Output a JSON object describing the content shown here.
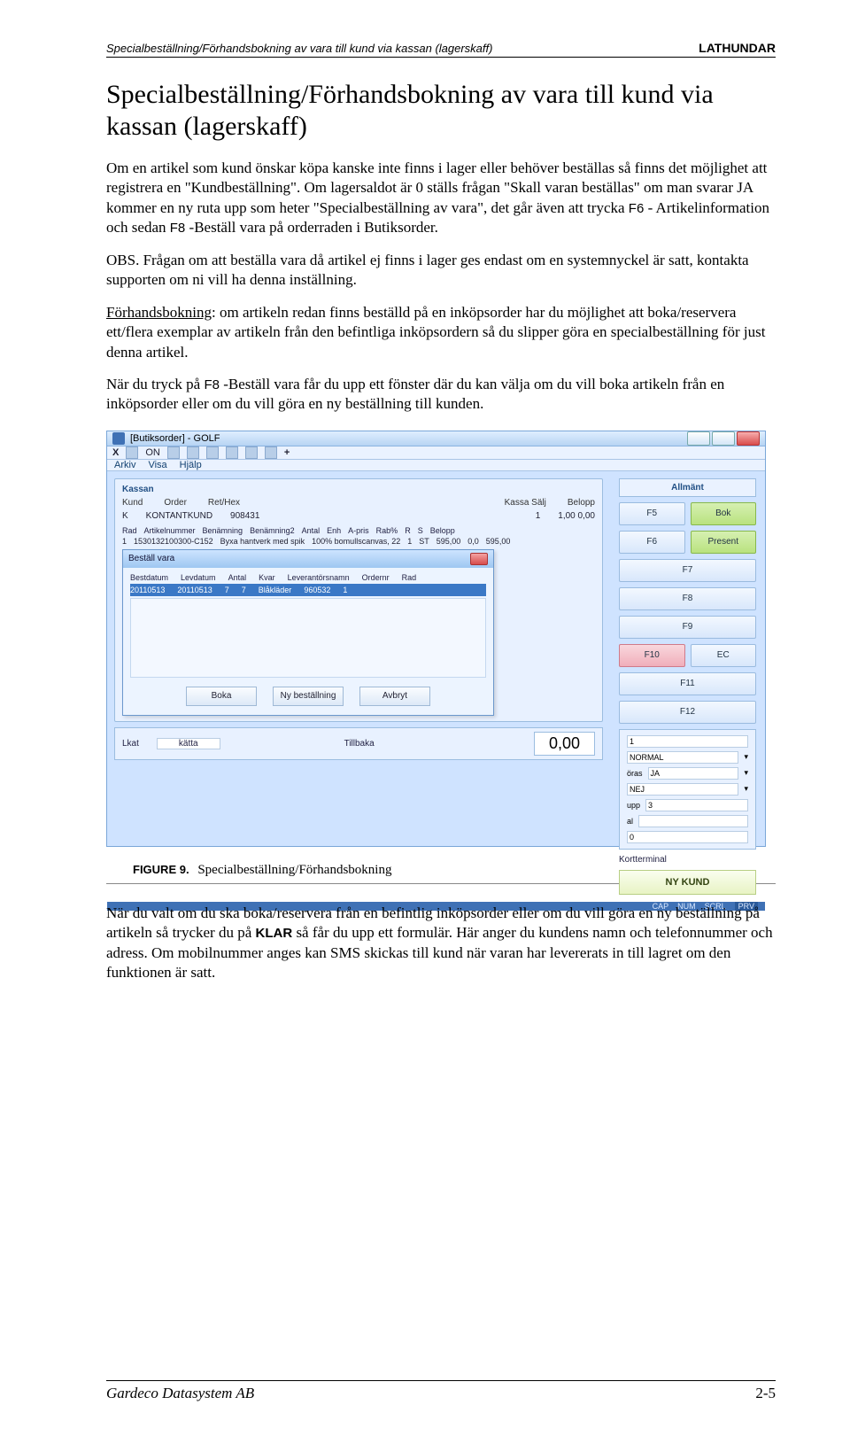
{
  "header": {
    "left": "Specialbeställning/Förhandsbokning av vara till kund via kassan (lagerskaff)",
    "right": "LATHUNDAR"
  },
  "title": "Specialbeställning/Förhandsbokning av vara till kund via kassan (lagerskaff)",
  "paragraphs": {
    "p1a": "Om en artikel som kund önskar köpa kanske inte finns i lager eller behöver beställas så finns det möjlighet att registrera en \"Kundbeställning\". Om lagersaldot är 0 ställs frågan \"Skall varan beställas\" om man svarar JA kommer en ny ruta upp som heter \"Specialbeställning av vara\", det går även att trycka ",
    "p1_f6": "F6",
    "p1b": "- Artikelinformation och sedan ",
    "p1_f8": "F8",
    "p1c": "-Beställ vara på orderraden i Butiksorder.",
    "p2": "OBS. Frågan om att beställa vara då artikel ej finns i lager ges endast om en systemnyckel är satt, kontakta supporten om ni vill ha denna inställning.",
    "p3a": "Förhandsbokning",
    "p3b": ": om artikeln redan finns beställd på en inköpsorder har du möjlighet att boka/reservera ett/flera exemplar av artikeln från den befintliga inköpsordern så du slipper göra en specialbeställning för just denna artikel.",
    "p4a": "När du tryck på ",
    "p4_f8": "F8",
    "p4b": "-Beställ vara får du upp ett fönster där du kan välja om du vill boka artikeln från en inköpsorder eller om du vill göra en ny beställning till kunden."
  },
  "screenshot": {
    "window_title": "[Butiksorder] - GOLF",
    "menu": {
      "arkiv": "Arkiv",
      "visa": "Visa",
      "hjalp": "Hjälp"
    },
    "tab_kassa": "Kassan",
    "kund_header": {
      "kund": "Kund",
      "order": "Order",
      "rethex": "Ret/Hex",
      "kassa": "Kassa Sälj",
      "belopp": "Belopp"
    },
    "kund_row": {
      "k": "K",
      "name": "KONTANTKUND",
      "order": "908431",
      "kassa": "1",
      "sum": "1,00  0,00"
    },
    "table_header": {
      "rad": "Rad",
      "art": "Artikelnummer",
      "ben": "Benämning",
      "ben2": "Benämning2",
      "antal": "Antal",
      "enh": "Enh",
      "apris": "A-pris",
      "rab": "Rab%",
      "r": "R",
      "s": "S",
      "bel": "Belopp"
    },
    "table_row": {
      "rad": "1",
      "art": "1530132100300-C152",
      "ben": "Byxa hantverk med spik",
      "ben2": "100% bomullscanvas, 22",
      "antal": "1",
      "enh": "ST",
      "apris": "595,00",
      "rab": "0,0",
      "bel": "595,00"
    },
    "dialog": {
      "title": "Beställ vara",
      "h": {
        "best": "Bestdatum",
        "lev": "Levdatum",
        "antal": "Antal",
        "kvar": "Kvar",
        "levnamn": "Leverantörsnamn",
        "ordernr": "Ordernr",
        "rad": "Rad"
      },
      "r": {
        "best": "20110513",
        "lev": "20110513",
        "antal": "7",
        "kvar": "7",
        "levnamn": "Blåkläder",
        "ordernr": "960532",
        "rad": "1"
      },
      "btn_boka": "Boka",
      "btn_ny": "Ny beställning",
      "btn_avbryt": "Avbryt"
    },
    "sidepanel": {
      "title": "Allmänt",
      "f5": "F5",
      "bok": "Bok",
      "f6": "F6",
      "present": "Present",
      "f7": "F7",
      "f8": "F8",
      "f9": "F9",
      "f10": "F10",
      "f11": "F11",
      "f12": "F12",
      "row1": "1",
      "normal": "NORMAL",
      "oras": "öras",
      "ja": "JA",
      "nej": "NEJ",
      "upp": "upp",
      "three": "3",
      "al": "al",
      "zero": "0",
      "kort": "Kortterminal",
      "nykund": "NY KUND",
      "ec": "EC"
    },
    "bottom": {
      "lkatt": "Lkat",
      "kätta": "kätta",
      "tillbaka": "Tillbaka",
      "total": "0,00"
    },
    "status": {
      "cap": "CAP",
      "num": "NUM",
      "scrl": "SCRL",
      "prv": "PRV"
    }
  },
  "figure": {
    "num": "FIGURE 9.",
    "cap": "Specialbeställning/Förhandsbokning"
  },
  "p5a": "När du valt om du ska boka/reservera från en befintlig inköpsorder eller om du vill göra en ny beställning på artikeln så trycker du på ",
  "p5_klar": "KLAR",
  "p5b": " så får du upp ett formulär. Här anger du kundens namn och telefonnummer och adress. Om mobilnummer anges kan SMS skickas till kund när varan har levererats in till lagret om den funktionen är satt.",
  "footer": {
    "left": "Gardeco Datasystem AB",
    "right": "2-5"
  }
}
